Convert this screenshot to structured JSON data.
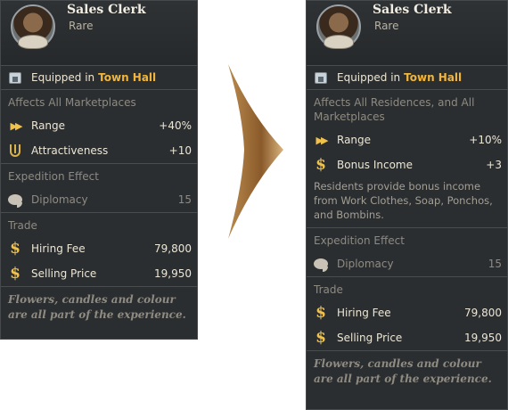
{
  "left_card": {
    "name": "Sales Clerk",
    "rarity": "Rare",
    "equipped_prefix": "Equipped in",
    "equipped_place": "Town Hall",
    "affects": "Affects All Marketplaces",
    "stats": [
      {
        "icon": "double-arrow-icon",
        "label": "Range",
        "value": "+40%"
      },
      {
        "icon": "lyre-icon",
        "label": "Attractiveness",
        "value": "+10"
      }
    ],
    "expedition_title": "Expedition Effect",
    "expedition_stat": {
      "icon": "speech-bubble-icon",
      "label": "Diplomacy",
      "value": "15"
    },
    "trade_title": "Trade",
    "trade": [
      {
        "icon": "dollar-icon",
        "label": "Hiring Fee",
        "value": "79,800"
      },
      {
        "icon": "dollar-icon",
        "label": "Selling Price",
        "value": "19,950"
      }
    ],
    "flavor": "Flowers, candles and colour are all part of the experience."
  },
  "right_card": {
    "name": "Sales Clerk",
    "rarity": "Rare",
    "equipped_prefix": "Equipped in",
    "equipped_place": "Town Hall",
    "affects": "Affects All Residences, and All Marketplaces",
    "stats": [
      {
        "icon": "double-arrow-icon",
        "label": "Range",
        "value": "+10%"
      },
      {
        "icon": "dollar-icon",
        "label": "Bonus Income",
        "value": "+3"
      }
    ],
    "description": "Residents provide bonus income from Work Clothes, Soap, Ponchos, and Bombins.",
    "expedition_title": "Expedition Effect",
    "expedition_stat": {
      "icon": "speech-bubble-icon",
      "label": "Diplomacy",
      "value": "15"
    },
    "trade_title": "Trade",
    "trade": [
      {
        "icon": "dollar-icon",
        "label": "Hiring Fee",
        "value": "79,800"
      },
      {
        "icon": "dollar-icon",
        "label": "Selling Price",
        "value": "19,950"
      }
    ],
    "flavor": "Flowers, candles and colour are all part of the experience."
  },
  "colors": {
    "accent": "#f0b53a",
    "panel": "#2b2e30",
    "arrow": "#c8a06a"
  }
}
